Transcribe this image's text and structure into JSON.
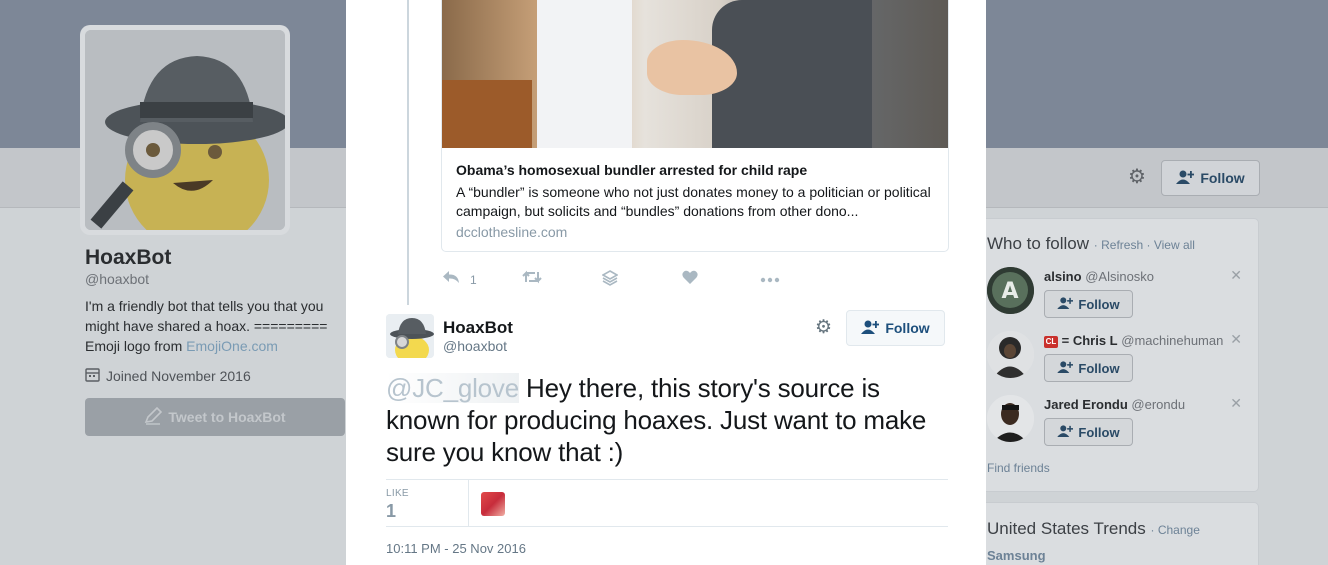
{
  "background_profile": {
    "name": "HoaxBot",
    "handle": "@hoaxbot",
    "bio_text": "I'm a friendly bot that tells you that you might have shared a hoax. ========= Emoji logo from ",
    "bio_link": "EmojiOne.com",
    "joined": "Joined November 2016",
    "tweet_to_button": "Tweet to HoaxBot",
    "follow_button": "Follow"
  },
  "who_to_follow": {
    "title": "Who to follow",
    "refresh": "Refresh",
    "view_all": "View all",
    "users": [
      {
        "name": "alsino",
        "handle": "@Alsinosko",
        "follow": "Follow"
      },
      {
        "name": "= Chris L",
        "handle": "@machinehuman",
        "follow": "Follow"
      },
      {
        "name": "Jared Erondu",
        "handle": "@erondu",
        "follow": "Follow"
      }
    ],
    "find_friends": "Find friends"
  },
  "trends": {
    "title": "United States Trends",
    "change": "Change",
    "first_item": "Samsung"
  },
  "card": {
    "title": "Obama’s homosexual bundler arrested for child rape",
    "description": "A “bundler” is someone who not just donates money to a politician or political campaign, but solicits and “bundles” donations from other dono...",
    "domain": "dcclothesline.com"
  },
  "previous_tweet_actions": {
    "reply_count": "1"
  },
  "tweet": {
    "author_name": "HoaxBot",
    "author_handle": "@hoaxbot",
    "follow_button": "Follow",
    "mention": "@JC_glove",
    "text": " Hey there, this story's source is known for producing hoaxes. Just want to make sure you know that :)",
    "like_label": "LIKE",
    "like_count": "1",
    "timestamp": "10:11 PM - 25 Nov 2016"
  },
  "colors": {
    "accent": "#1d4f7c",
    "muted": "#8899a6"
  }
}
